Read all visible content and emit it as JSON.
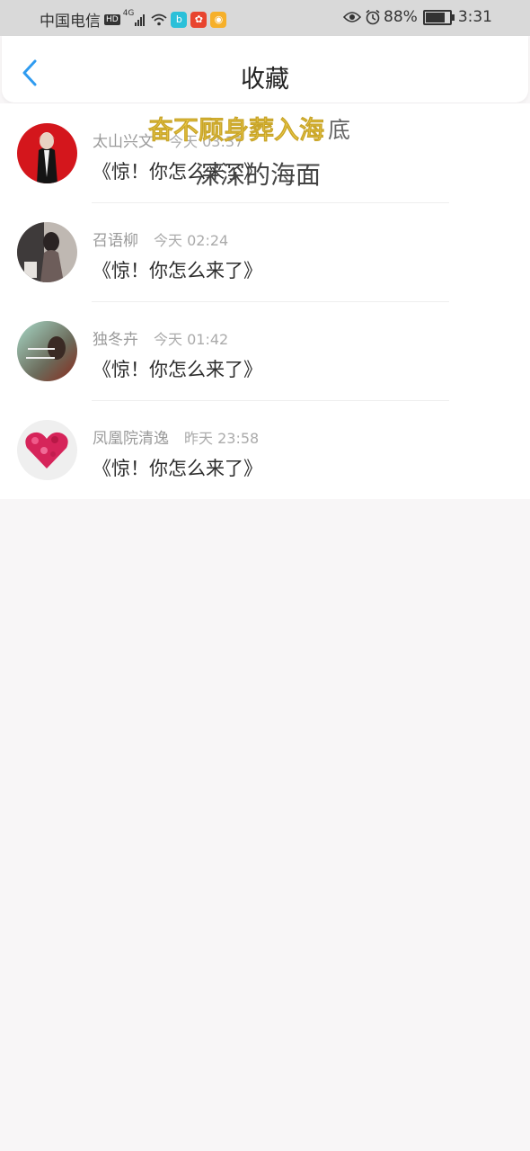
{
  "status_bar": {
    "carrier": "中国电信",
    "hd": "HD",
    "network": "4G",
    "battery_percent_text": "88%",
    "battery_level": 0.88,
    "time": "3:31"
  },
  "header": {
    "title": "收藏"
  },
  "favorites": [
    {
      "name": "太山兴文",
      "time": "今天 03:37",
      "content": "《惊！你怎么来了》"
    },
    {
      "name": "召语柳",
      "time": "今天 02:24",
      "content": "《惊！你怎么来了》"
    },
    {
      "name": "独冬卉",
      "time": "今天 01:42",
      "content": "《惊！你怎么来了》"
    },
    {
      "name": "凤凰院清逸",
      "time": "昨天 23:58",
      "content": "《惊！你怎么来了》"
    }
  ],
  "overlay_lyrics": {
    "line1_highlight": "奋不顾身葬入海",
    "line1_rest": "底",
    "line2": "深深的海面"
  },
  "colors": {
    "accent": "#2f9bf0",
    "background": "#f8f6f7",
    "lyric_highlight": "#f3cf4a"
  }
}
